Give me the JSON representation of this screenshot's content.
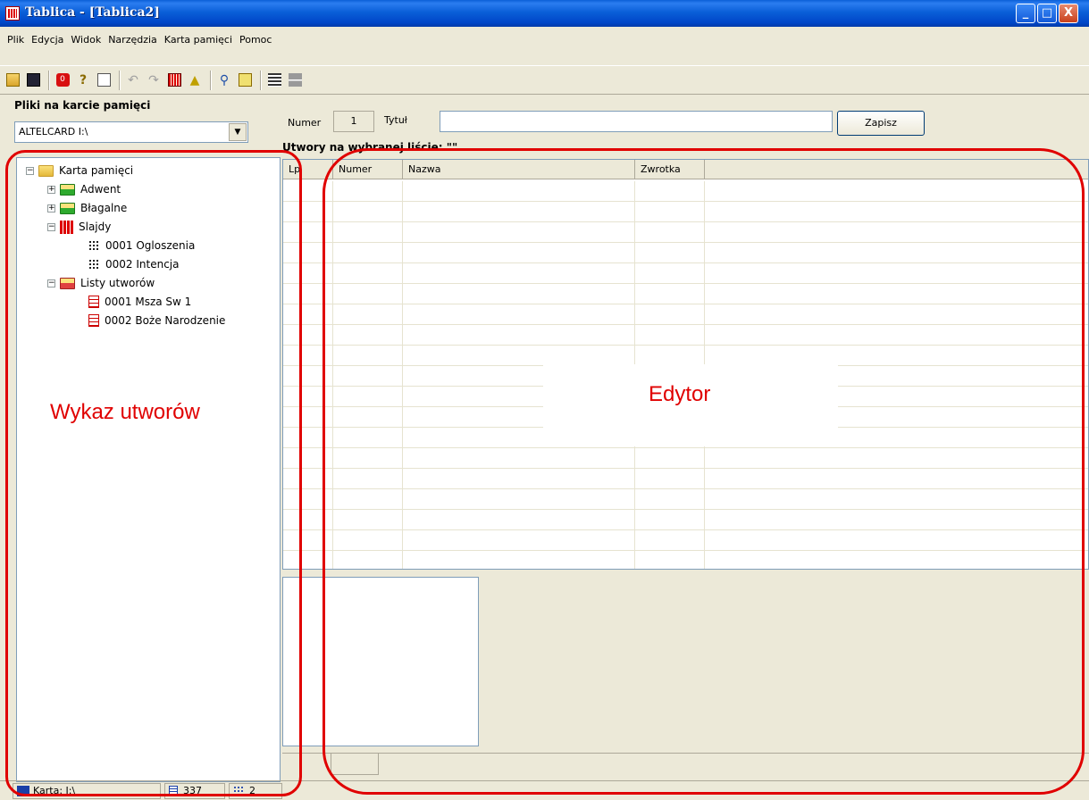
{
  "window": {
    "title": "Tablica - [Tablica2]"
  },
  "window_controls": {
    "minimize": "_",
    "maximize": "□",
    "close": "X"
  },
  "menu": [
    "Plik",
    "Edycja",
    "Widok",
    "Narzędzia",
    "Karta pamięci",
    "Pomoc"
  ],
  "toolbar": {
    "icons": [
      "open-icon",
      "save-icon",
      "stop-icon",
      "help-icon",
      "properties-icon",
      "undo-icon",
      "redo-icon",
      "slides-icon",
      "warning-icon",
      "find-icon",
      "replace-icon",
      "list-view-icon",
      "list-view2-icon"
    ]
  },
  "left_panel": {
    "header": "Pliki na karcie pamięci",
    "drive": "ALTELCARD I:\\",
    "tree": {
      "root": "Karta pamięci",
      "adwent": "Adwent",
      "blagalne": "Błagalne",
      "slajdy": "Slajdy",
      "slide1": "0001 Ogloszenia",
      "slide2": "0002 Intencja",
      "listy": "Listy utworów",
      "list1": "0001 Msza Sw 1",
      "list2": "0002 Boże Narodzenie"
    }
  },
  "editor": {
    "numer_label": "Numer",
    "numer_value": "1",
    "tytul_label": "Tytuł",
    "tytul_value": "",
    "save_button": "Zapisz",
    "list_label": "Utwory na wybranej liście: \"\"",
    "columns": [
      "Lp",
      "Numer",
      "Nazwa",
      "Zwrotka"
    ]
  },
  "statusbar": {
    "card": "Karta: I:\\",
    "count1": "337",
    "count2": "2"
  },
  "annotations": {
    "left": "Wykaz utworów",
    "right": "Edytor"
  },
  "colors": {
    "annotation": "#e00000",
    "titlebar": "#0a5fd8",
    "panel_bg": "#ece9d8"
  }
}
